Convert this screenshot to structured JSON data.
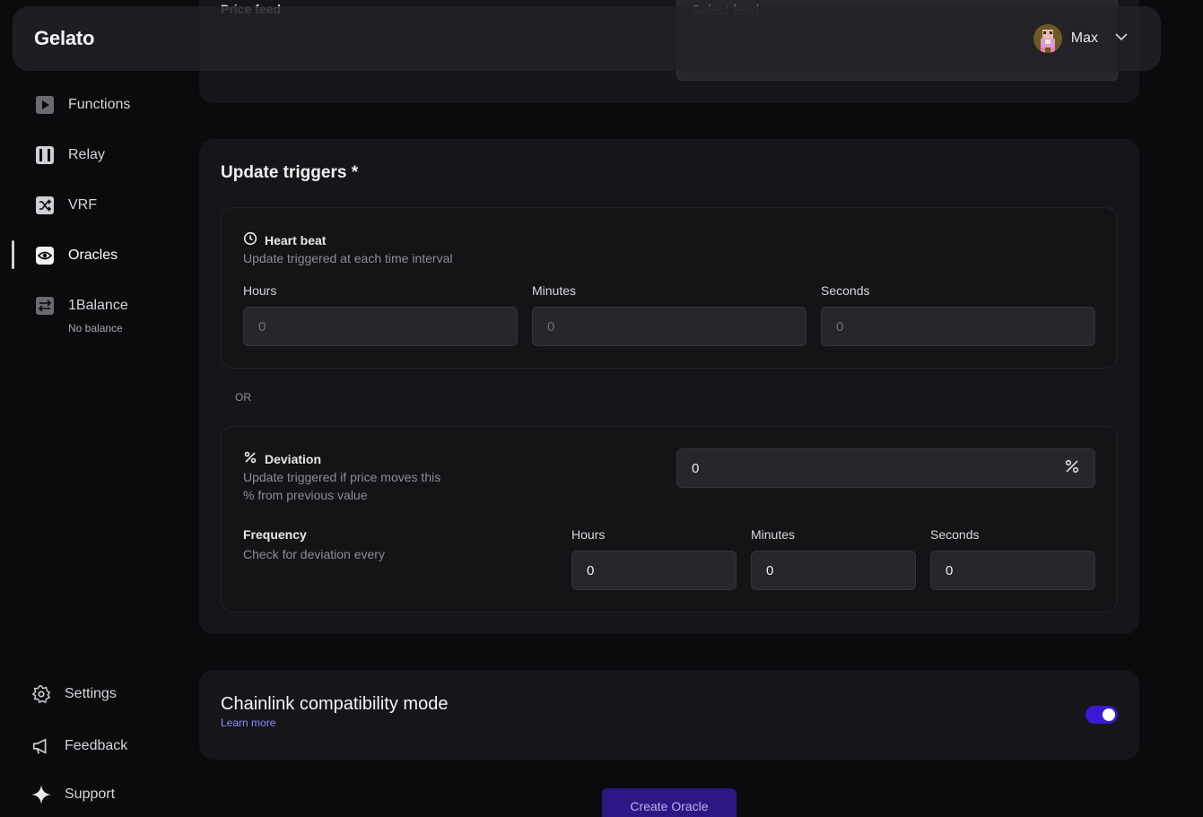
{
  "header": {
    "logo": "Gelato",
    "user_name": "Max"
  },
  "top_section": {
    "label": "Price feed",
    "placeholder": "Select feed"
  },
  "sidebar": {
    "items": [
      {
        "label": "Functions",
        "icon": "play-icon"
      },
      {
        "label": "Relay",
        "icon": "relay-icon"
      },
      {
        "label": "VRF",
        "icon": "shuffle-icon"
      },
      {
        "label": "Oracles",
        "icon": "eye-icon"
      },
      {
        "label": "1Balance",
        "icon": "transfer-icon",
        "sub": "No balance"
      }
    ],
    "bottom": [
      {
        "label": "Settings",
        "icon": "gear-icon"
      },
      {
        "label": "Feedback",
        "icon": "megaphone-icon"
      },
      {
        "label": "Support",
        "icon": "sparkle-icon"
      }
    ]
  },
  "triggers": {
    "title": "Update triggers *",
    "heartbeat": {
      "title": "Heart beat",
      "desc": "Update triggered at each time interval",
      "fields": [
        {
          "label": "Hours",
          "placeholder": "0"
        },
        {
          "label": "Minutes",
          "placeholder": "0"
        },
        {
          "label": "Seconds",
          "placeholder": "0"
        }
      ]
    },
    "or_label": "OR",
    "deviation": {
      "title": "Deviation",
      "desc_line1": "Update triggered if price moves this",
      "desc_line2": "% from previous value",
      "value": "0",
      "frequency_title": "Frequency",
      "frequency_desc": "Check for deviation every",
      "fields": [
        {
          "label": "Hours",
          "value": "0"
        },
        {
          "label": "Minutes",
          "value": "0"
        },
        {
          "label": "Seconds",
          "value": "0"
        }
      ]
    }
  },
  "chainlink": {
    "title": "Chainlink compatibility mode",
    "link": "Learn more",
    "enabled": true
  },
  "create_button": "Create Oracle",
  "colors": {
    "accent": "#3b17d6",
    "link": "#8f89ff"
  }
}
